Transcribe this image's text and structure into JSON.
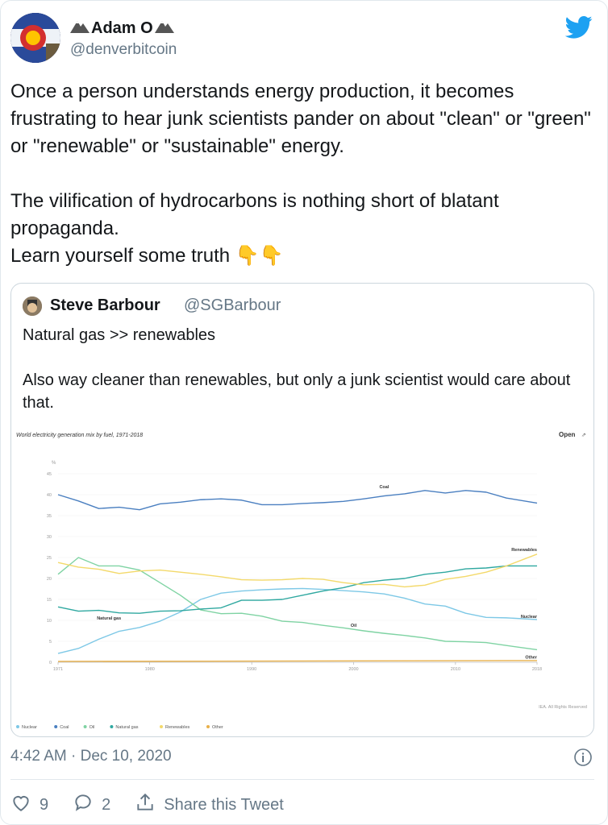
{
  "author": {
    "name": "Adam O",
    "handle": "@denverbitcoin"
  },
  "tweet": {
    "text": "Once a person understands energy production, it becomes frustrating to hear junk scientists pander on about \"clean\" or \"green\" or \"renewable\" or \"sustainable\" energy.\n\nThe vilification of hydrocarbons is nothing short of blatant propaganda.\nLearn yourself some truth",
    "emoji": "👇👇"
  },
  "quote": {
    "name": "Steve Barbour",
    "handle": "@SGBarbour",
    "text": "Natural gas >> renewables\n\nAlso way cleaner than renewables, but only a junk scientist would care about that."
  },
  "meta": {
    "time": "4:42 AM · Dec 10, 2020"
  },
  "actions": {
    "likes": "9",
    "replies": "2",
    "share_label": "Share this Tweet"
  },
  "colors": {
    "accent": "#1da1f2",
    "muted": "#657786"
  },
  "icons": [
    "twitter-bird-icon",
    "info-icon",
    "heart-icon",
    "reply-icon",
    "share-icon"
  ],
  "chart_data": {
    "type": "line",
    "title": "World electricity generation mix by fuel, 1971-2018",
    "open_label": "Open",
    "ylabel": "%",
    "ylim": [
      0,
      45
    ],
    "yticks": [
      0,
      5,
      10,
      15,
      20,
      25,
      30,
      35,
      40,
      45
    ],
    "xlim": [
      1971,
      2018
    ],
    "xticks": [
      1971,
      1980,
      1990,
      2000,
      2010,
      2018
    ],
    "credit": "IEA. All Rights Reserved",
    "series": [
      {
        "name": "Nuclear",
        "color": "#7dc8e6",
        "x": [
          1971,
          1973,
          1975,
          1977,
          1979,
          1981,
          1983,
          1985,
          1987,
          1989,
          1991,
          1993,
          1995,
          1997,
          1999,
          2001,
          2003,
          2005,
          2007,
          2009,
          2011,
          2013,
          2015,
          2018
        ],
        "y": [
          2.1,
          3.3,
          5.5,
          7.4,
          8.3,
          9.8,
          12.0,
          15.0,
          16.5,
          17.0,
          17.3,
          17.5,
          17.6,
          17.4,
          17.1,
          16.8,
          16.3,
          15.3,
          13.9,
          13.4,
          11.7,
          10.7,
          10.6,
          10.2
        ]
      },
      {
        "name": "Coal",
        "color": "#4a7fc0",
        "x": [
          1971,
          1973,
          1975,
          1977,
          1979,
          1981,
          1983,
          1985,
          1987,
          1989,
          1991,
          1993,
          1995,
          1997,
          1999,
          2001,
          2003,
          2005,
          2007,
          2009,
          2011,
          2013,
          2015,
          2018
        ],
        "y": [
          40.0,
          38.5,
          36.7,
          37.0,
          36.4,
          37.8,
          38.2,
          38.8,
          39.0,
          38.7,
          37.6,
          37.6,
          37.9,
          38.1,
          38.4,
          39.0,
          39.7,
          40.2,
          41.0,
          40.4,
          41.0,
          40.6,
          39.2,
          38.0
        ]
      },
      {
        "name": "Oil",
        "color": "#7fd3a3",
        "x": [
          1971,
          1973,
          1975,
          1977,
          1979,
          1981,
          1983,
          1985,
          1987,
          1989,
          1991,
          1993,
          1995,
          1997,
          1999,
          2001,
          2003,
          2005,
          2007,
          2009,
          2011,
          2013,
          2015,
          2018
        ],
        "y": [
          21.0,
          25.0,
          23.0,
          23.0,
          22.0,
          19.0,
          16.0,
          12.5,
          11.6,
          11.7,
          11.0,
          9.8,
          9.5,
          8.8,
          8.2,
          7.5,
          6.9,
          6.4,
          5.8,
          5.0,
          4.9,
          4.7,
          4.0,
          3.0
        ]
      },
      {
        "name": "Natural gas",
        "color": "#2fa8a0",
        "x": [
          1971,
          1973,
          1975,
          1977,
          1979,
          1981,
          1983,
          1985,
          1987,
          1989,
          1991,
          1993,
          1995,
          1997,
          1999,
          2001,
          2003,
          2005,
          2007,
          2009,
          2011,
          2013,
          2015,
          2018
        ],
        "y": [
          13.2,
          12.2,
          12.4,
          11.8,
          11.7,
          12.2,
          12.3,
          12.7,
          13.0,
          14.8,
          14.8,
          15.0,
          16.0,
          17.0,
          17.8,
          19.0,
          19.6,
          20.0,
          21.0,
          21.5,
          22.3,
          22.5,
          23.0,
          23.0
        ]
      },
      {
        "name": "Renewables",
        "color": "#f3d96a",
        "x": [
          1971,
          1973,
          1975,
          1977,
          1979,
          1981,
          1983,
          1985,
          1987,
          1989,
          1991,
          1993,
          1995,
          1997,
          1999,
          2001,
          2003,
          2005,
          2007,
          2009,
          2011,
          2013,
          2015,
          2018
        ],
        "y": [
          23.8,
          22.7,
          22.2,
          21.2,
          21.8,
          22.0,
          21.5,
          21.0,
          20.4,
          19.7,
          19.6,
          19.7,
          20.0,
          19.8,
          19.0,
          18.5,
          18.6,
          18.0,
          18.4,
          19.8,
          20.5,
          21.5,
          23.0,
          25.8
        ]
      },
      {
        "name": "Other",
        "color": "#e8b04a",
        "x": [
          1971,
          2018
        ],
        "y": [
          0.2,
          0.4
        ]
      }
    ],
    "labels": [
      {
        "text": "Coal",
        "x": 2003,
        "y": 41.5
      },
      {
        "text": "Renewables",
        "x": 2018,
        "y": 26.5
      },
      {
        "text": "Nuclear",
        "x": 2018,
        "y": 10.6
      },
      {
        "text": "Natural gas",
        "x": 1976,
        "y": 10.2
      },
      {
        "text": "Oil",
        "x": 2000,
        "y": 8.5
      },
      {
        "text": "Other",
        "x": 2018,
        "y": 0.9
      }
    ]
  }
}
